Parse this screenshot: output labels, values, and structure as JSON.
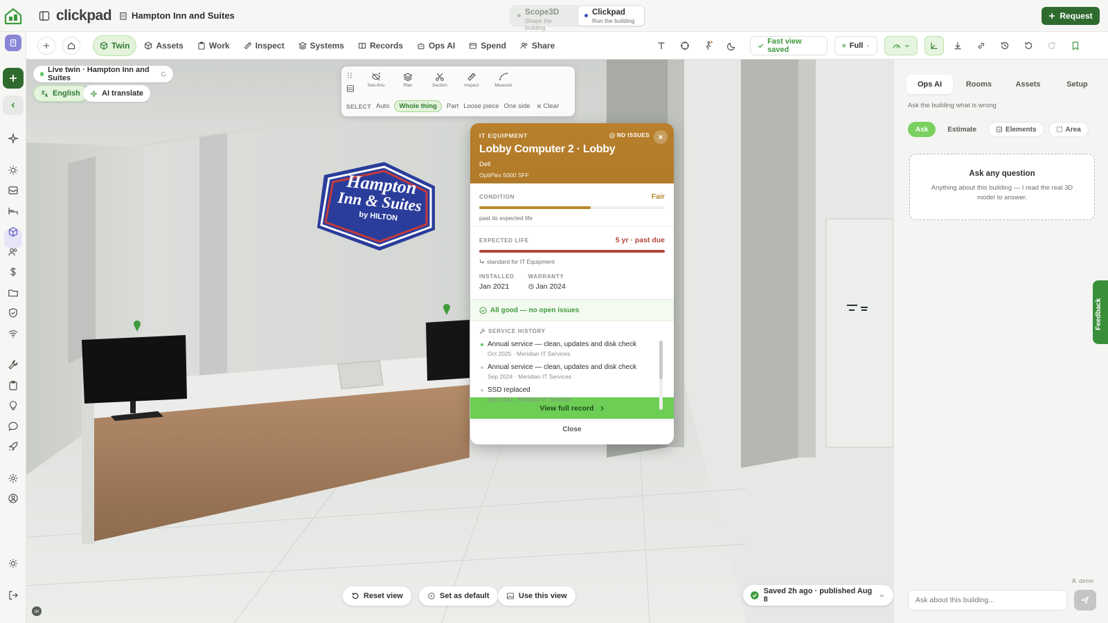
{
  "header": {
    "brand": "clickpad",
    "building": "Hampton Inn and Suites",
    "modes": [
      {
        "name": "Scope3D",
        "sub": "Shape the building"
      },
      {
        "name": "Clickpad",
        "sub": "Run the building"
      }
    ],
    "request_label": "Request"
  },
  "tabbar": {
    "tabs": [
      {
        "label": "Twin",
        "icon": "cube-icon"
      },
      {
        "label": "Assets",
        "icon": "box-icon"
      },
      {
        "label": "Work",
        "icon": "clipboard-icon"
      },
      {
        "label": "Inspect",
        "icon": "ruler-icon"
      },
      {
        "label": "Systems",
        "icon": "layers-icon"
      },
      {
        "label": "Records",
        "icon": "book-icon"
      },
      {
        "label": "Ops AI",
        "icon": "robot-icon"
      },
      {
        "label": "Spend",
        "icon": "card-icon"
      },
      {
        "label": "Share",
        "icon": "people-icon"
      }
    ],
    "fast_view_saved": "Fast view saved",
    "view_mode": "Full"
  },
  "viewport": {
    "live_twin": "Live twin · Hampton Inn and Suites",
    "language": "English",
    "ai_translate": "AI translate",
    "sign_line1": "Hampton",
    "sign_line2": "Inn & Suites",
    "sign_line3": "by HILTON",
    "select_tools": [
      "See-thru",
      "Plan",
      "Section",
      "Inspect",
      "Measure"
    ],
    "select_label": "SELECT",
    "select_options": [
      "Auto",
      "Whole thing",
      "Part",
      "Loose piece",
      "One side"
    ],
    "clear_label": "Clear",
    "bottom": {
      "reset": "Reset view",
      "set_default": "Set as default",
      "use_view": "Use this view"
    },
    "saved": "Saved 2h ago · published Aug 8",
    "dx": "dx"
  },
  "card": {
    "category": "IT EQUIPMENT",
    "status": "NO ISSUES",
    "title": "Lobby Computer 2 · Lobby",
    "make": "Dell",
    "model": "OptiPlex 5000 SFF",
    "condition_label": "CONDITION",
    "condition_value": "Fair",
    "condition_fraction": 0.6,
    "condition_note": "past its expected life",
    "life_label": "EXPECTED LIFE",
    "life_value": "5 yr · past due",
    "life_fraction": 1.0,
    "life_note": "standard for IT Equipment",
    "installed_label": "INSTALLED",
    "installed_value": "Jan 2021",
    "warranty_label": "WARRANTY",
    "warranty_value": "Jan 2024",
    "ok_message": "All good — no open issues",
    "history_title": "SERVICE HISTORY",
    "history": [
      {
        "title": "Annual service — clean, updates and disk check",
        "meta": "Oct 2025 · Meridian IT Services"
      },
      {
        "title": "Annual service — clean, updates and disk check",
        "meta": "Sep 2024 · Meridian IT Services"
      },
      {
        "title": "SSD replaced",
        "meta": "Sep 2023 · Meridian IT Services"
      }
    ],
    "view_full": "View full record",
    "close": "Close"
  },
  "panel": {
    "tabs": [
      "Ops AI",
      "Rooms",
      "Assets",
      "Setup"
    ],
    "hint": "Ask the building what is wrong",
    "subtabs": [
      "Ask",
      "Estimate",
      "Elements",
      "Area"
    ],
    "ask_title": "Ask any question",
    "ask_body": "Anything about this building — I read the real 3D model to answer.",
    "demo": "demo",
    "input_placeholder": "Ask about this building..."
  },
  "feedback": "Feedback",
  "colors": {
    "brand_green": "#2f6b2f",
    "accent_green": "#6dcd55",
    "card_head": "#b57d2a",
    "warn": "#b58a2a",
    "bad": "#b2453a"
  }
}
